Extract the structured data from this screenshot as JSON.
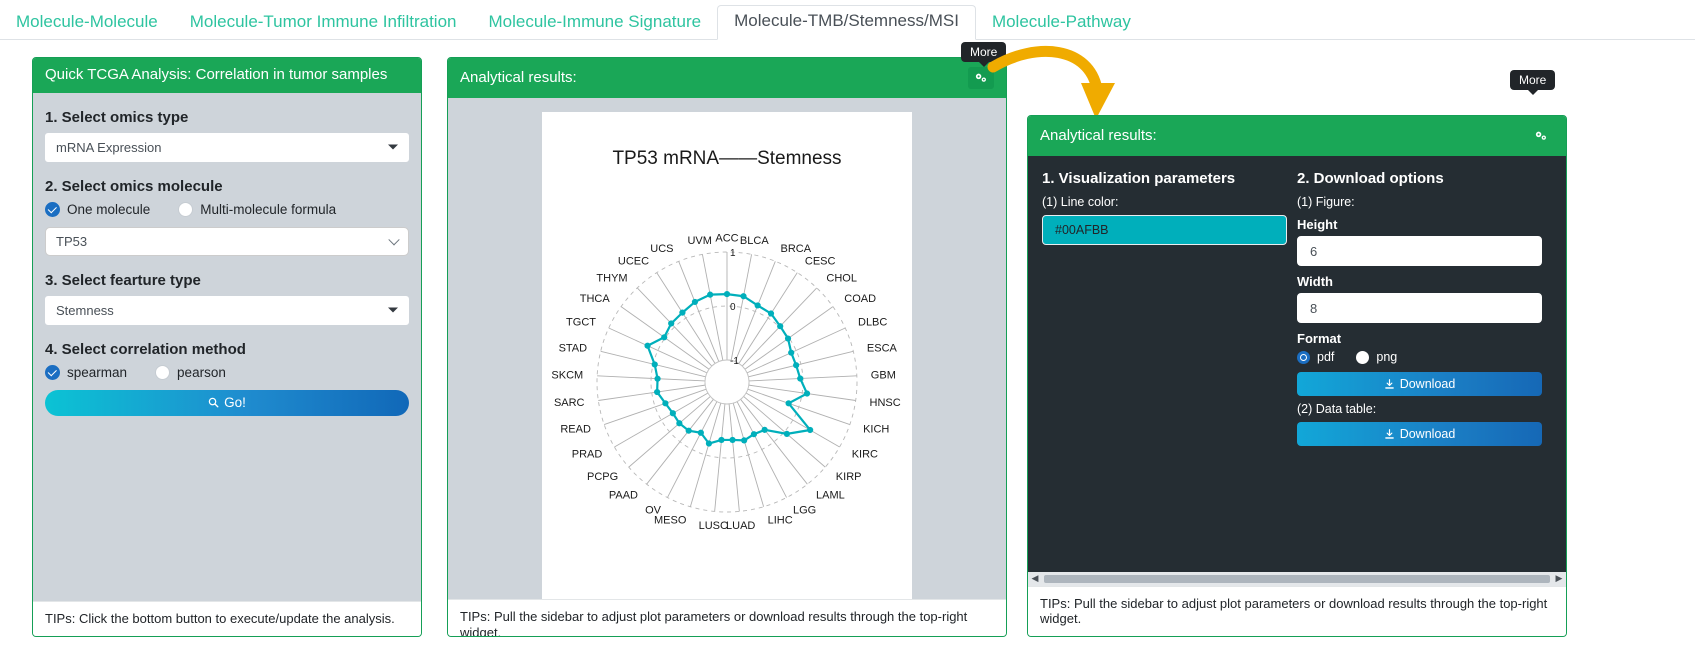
{
  "nav": {
    "tabs": [
      {
        "label": "Molecule-Molecule",
        "active": false
      },
      {
        "label": "Molecule-Tumor Immune Infiltration",
        "active": false
      },
      {
        "label": "Molecule-Immune Signature",
        "active": false
      },
      {
        "label": "Molecule-TMB/Stemness/MSI",
        "active": true
      },
      {
        "label": "Molecule-Pathway",
        "active": false
      }
    ]
  },
  "left_panel": {
    "title": "Quick TCGA Analysis: Correlation in tumor samples",
    "step1_label": "1. Select omics type",
    "omics_type_value": "mRNA Expression",
    "step2_label": "2. Select omics molecule",
    "molecule_mode_one": "One molecule",
    "molecule_mode_multi": "Multi-molecule formula",
    "molecule_value": "TP53",
    "step3_label": "3. Select fearture type",
    "feature_type_value": "Stemness",
    "step4_label": "4. Select correlation method",
    "method_spearman": "spearman",
    "method_pearson": "pearson",
    "go_label": "Go!",
    "tips": "TIPs: Click the bottom button to execute/update the analysis."
  },
  "mid_panel": {
    "title": "Analytical results:",
    "widget_tooltip": "More",
    "widget_icon": "gears-icon",
    "tips": "TIPs: Pull the sidebar to adjust plot parameters or download results through the top-right widget."
  },
  "right_panel": {
    "title": "Analytical results:",
    "widget_tooltip": "More",
    "widget_icon": "gears-icon",
    "viz_heading": "1. Visualization parameters",
    "line_color_label": "(1) Line color:",
    "line_color_value": "#00AFBB",
    "download_heading": "2. Download options",
    "figure_label": "(1) Figure:",
    "height_label": "Height",
    "height_value": "6",
    "width_label": "Width",
    "width_value": "8",
    "format_label": "Format",
    "format_pdf": "pdf",
    "format_png": "png",
    "download_figure_label": "Download",
    "data_table_label": "(2) Data table:",
    "download_table_label": "Download",
    "tips": "TIPs: Pull the sidebar to adjust plot parameters or download results through the top-right widget."
  },
  "chart_data": {
    "type": "radar",
    "title": "TP53 mRNA——Stemness",
    "xlabel": "",
    "ylabel": "",
    "rlim": [
      -1,
      1
    ],
    "rticks": [
      1,
      0,
      -1
    ],
    "grid": true,
    "legend": false,
    "line_color": "#00AFBB",
    "categories": [
      "ACC",
      "BLCA",
      "BRCA",
      "CESC",
      "CHOL",
      "COAD",
      "DLBC",
      "ESCA",
      "GBM",
      "HNSC",
      "KICH",
      "KIRC",
      "KIRP",
      "LAML",
      "LGG",
      "LIHC",
      "LUAD",
      "LUSC",
      "MESO",
      "OV",
      "PAAD",
      "PCPG",
      "PRAD",
      "READ",
      "SARC",
      "SKCM",
      "STAD",
      "TGCT",
      "THCA",
      "THYM",
      "UCEC",
      "UCS",
      "UVM"
    ],
    "values": [
      0.22,
      0.21,
      0.12,
      0.1,
      0.02,
      -0.02,
      -0.1,
      -0.09,
      -0.05,
      0.09,
      -0.2,
      0.37,
      0.06,
      -0.28,
      -0.32,
      -0.28,
      -0.33,
      -0.33,
      -0.22,
      -0.35,
      -0.26,
      -0.24,
      -0.25,
      -0.2,
      -0.1,
      -0.12,
      -0.03,
      0.21,
      0.02,
      0.09,
      0.12,
      0.19,
      0.24
    ]
  }
}
